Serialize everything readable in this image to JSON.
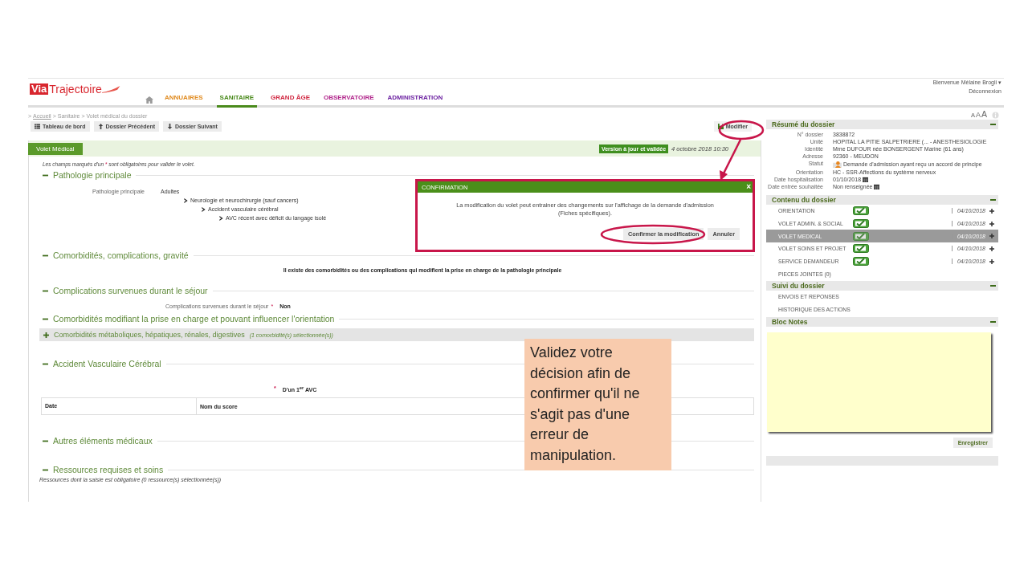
{
  "header": {
    "logo_badge": "Via",
    "logo_text": "Trajectoire",
    "nav": [
      {
        "label": "ANNUAIRES",
        "color": "#e08a1e",
        "selected": false
      },
      {
        "label": "SANITAIRE",
        "color": "#4a8a1c",
        "selected": true
      },
      {
        "label": "GRAND ÂGE",
        "color": "#d0253f",
        "selected": false
      },
      {
        "label": "OBSERVATOIRE",
        "color": "#b0238a",
        "selected": false
      },
      {
        "label": "ADMINISTRATION",
        "color": "#6a1fa0",
        "selected": false
      }
    ],
    "user": {
      "welcome": "Bienvenue Mélaine Brogli",
      "caret": "▾",
      "logout": "Déconnexion"
    }
  },
  "breadcrumb": {
    "separator": ">",
    "items": [
      {
        "label": "Accueil",
        "link": true
      },
      {
        "label": "Sanitaire",
        "link": false
      },
      {
        "label": "Volet médical du dossier",
        "link": false
      }
    ]
  },
  "font_sizes": [
    "A",
    "A",
    "A"
  ],
  "toolbar": {
    "buttons": [
      {
        "label": "Tableau de bord"
      },
      {
        "label": "Dossier Précédent"
      },
      {
        "label": "Dossier Suivant"
      }
    ],
    "modify": "Modifier"
  },
  "volet": {
    "title": "Volet Médical",
    "status": "Version à jour et validée",
    "date": "4 octobre 2018 10:30",
    "note": {
      "before": "Les champs marqués d'un",
      "mark": "*",
      "after": "sont obligatoires pour valider le volet."
    },
    "sections": [
      {
        "title": "Pathologie principale",
        "expanded": true,
        "kind": "tree",
        "label": "Pathologie principale",
        "tree": {
          "label": "Adultes",
          "children": [
            {
              "label": "Neurologie et neurochirurgie (sauf cancers)",
              "children": [
                {
                  "label": "Accident vasculaire cérébral",
                  "children": [
                    {
                      "label": "AVC récent avec déficit du langage isolé"
                    }
                  ]
                }
              ]
            }
          ]
        }
      },
      {
        "title": "Comorbidités, complications, gravité",
        "expanded": true,
        "kind": "statement",
        "text": "Il existe des comorbidités ou des complications qui modifient la prise en charge de la pathologie principale"
      },
      {
        "title": "Complications survenues durant le séjour",
        "expanded": true,
        "kind": "field",
        "label": "Complications survenues durant le séjour",
        "required": true,
        "value": "Non"
      },
      {
        "title": "Comorbidités modifiant la prise en charge et pouvant influencer l'orientation",
        "expanded": true,
        "kind": "group",
        "group": {
          "title": "Comorbidités métaboliques, hépatiques, rénales, digestives",
          "note": "(1 comorbidité(s) sélectionnée(s))",
          "expanded": false
        }
      },
      {
        "title": "Accident Vasculaire Cérébral",
        "expanded": true,
        "kind": "avc",
        "required": true,
        "label": "D'un 1$^{er}$ AVC",
        "columns": [
          "Date",
          "Nom du score"
        ]
      },
      {
        "title": "Autres éléments médicaux",
        "expanded": true,
        "kind": "empty"
      },
      {
        "title": "Ressources requises et soins",
        "expanded": true,
        "kind": "note",
        "note": "Ressources dont la saisie est obligatoire (0 ressource(s) sélectionnée(s))"
      }
    ]
  },
  "modal": {
    "title": "CONFIRMATION",
    "close": "×",
    "message": "La modification du volet peut entrainer des changements sur l'affichage de la demande d'admission (Fiches spécifiques).",
    "confirm": "Confirmer la modification",
    "cancel": "Annuler"
  },
  "summary": {
    "title": "Résumé du dossier",
    "expanded": true,
    "fields": [
      {
        "label": "N° dossier",
        "value": "3838872",
        "kind": "text"
      },
      {
        "label": "Unité",
        "value": "HOPITAL LA PITIE SALPETRIERE (... - ANESTHESIOLOGIE",
        "kind": "text"
      },
      {
        "label": "Identité",
        "value": "Mme DUFOUR née BONSERGENT Marine (61 ans)",
        "kind": "text"
      },
      {
        "label": "Adresse",
        "value": "92360 - MEUDON",
        "kind": "text"
      },
      {
        "label": "Statut",
        "value": "Demande d'admission ayant reçu un accord de principe",
        "kind": "status"
      },
      {
        "label": "Orientation",
        "value": "HC - SSR-Affections du système nerveux",
        "kind": "text"
      },
      {
        "label": "Date hospitalisation",
        "value": "01/10/2018",
        "kind": "date"
      },
      {
        "label": "Date entrée souhaitée",
        "value": "Non renseignée",
        "kind": "date"
      }
    ]
  },
  "contents": {
    "title": "Contenu du dossier",
    "expanded": true,
    "items": [
      {
        "label": "ORIENTATION",
        "kind": "section",
        "validated": true,
        "date": "04/10/2018",
        "selected": false
      },
      {
        "label": "VOLET ADMIN. & SOCIAL",
        "kind": "section",
        "validated": true,
        "date": "04/10/2018",
        "selected": false
      },
      {
        "label": "VOLET MEDICAL",
        "kind": "section",
        "validated": true,
        "date": "04/10/2018",
        "selected": true
      },
      {
        "label": "VOLET SOINS ET PROJET",
        "kind": "section",
        "validated": true,
        "date": "04/10/2018",
        "selected": false
      },
      {
        "label": "SERVICE DEMANDEUR",
        "kind": "section",
        "validated": true,
        "date": "04/10/2018",
        "selected": false
      },
      {
        "label": "PIECES JOINTES (0)",
        "kind": "link",
        "selected": false
      }
    ]
  },
  "tracking": {
    "title": "Suivi du dossier",
    "expanded": true,
    "items": [
      "ENVOIS ET REPONSES",
      "HISTORIQUE DES ACTIONS"
    ]
  },
  "notes": {
    "title": "Bloc Notes",
    "expanded": true,
    "save": "Enregistrer"
  },
  "callout": {
    "text": "Validez votre décision afin de confirmer qu'il ne s'agit pas d'une erreur de manipulation."
  }
}
